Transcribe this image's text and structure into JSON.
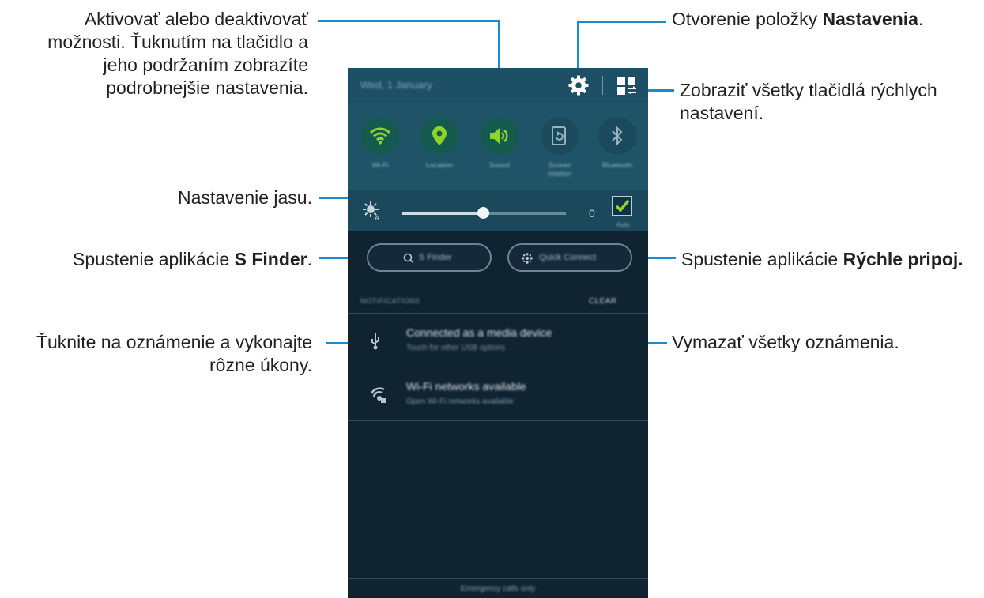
{
  "annotations": {
    "toggle_options": {
      "line1": "Aktivovať alebo deaktivovať",
      "line2": "možnosti. Ťuknutím na tlačidlo a",
      "line3": "jeho podržaním zobrazíte",
      "line4": "podrobnejšie nastavenia."
    },
    "settings": {
      "prefix": "Otvorenie položky ",
      "bold": "Nastavenia",
      "suffix": "."
    },
    "all_buttons": {
      "line1": "Zobraziť všetky tlačidlá rýchlych",
      "line2": "nastavení."
    },
    "brightness": "Nastavenie jasu.",
    "s_finder": {
      "prefix": "Spustenie aplikácie ",
      "bold": "S Finder",
      "suffix": "."
    },
    "quick_connect": {
      "prefix": "Spustenie aplikácie ",
      "bold": "Rýchle pripoj."
    },
    "notification": {
      "line1": "Ťuknite na oznámenie a vykonajte",
      "line2": "rôzne úkony."
    },
    "clear_all": "Vymazať všetky oznámenia."
  },
  "phone": {
    "date": "Wed, 1 January",
    "toggles": [
      {
        "label": "Wi-Fi",
        "icon": "wifi-icon",
        "state": "on"
      },
      {
        "label": "Location",
        "icon": "location-icon",
        "state": "on"
      },
      {
        "label": "Sound",
        "icon": "sound-icon",
        "state": "on"
      },
      {
        "label": "Screen rotation",
        "icon": "rotation-icon",
        "state": "off"
      },
      {
        "label": "Bluetooth",
        "icon": "bluetooth-icon",
        "state": "off"
      }
    ],
    "brightness": {
      "value": "0",
      "level": 0.5,
      "auto_label": "Auto",
      "auto_checked": true
    },
    "s_finder_label": "S Finder",
    "quick_connect_label": "Quick Connect",
    "notifications_header": "NOTIFICATIONS",
    "clear_label": "CLEAR",
    "notifications": [
      {
        "title": "Connected as a media device",
        "subtitle": "Touch for other USB options",
        "icon": "usb-icon"
      },
      {
        "title": "Wi-Fi networks available",
        "subtitle": "Open Wi-Fi networks available",
        "icon": "wifi-networks-icon"
      }
    ],
    "emergency": "Emergency calls only"
  },
  "colors": {
    "callout_line": "#1a8ccd",
    "accent_on": "#8fd42d",
    "panel_bg": "#102331"
  }
}
